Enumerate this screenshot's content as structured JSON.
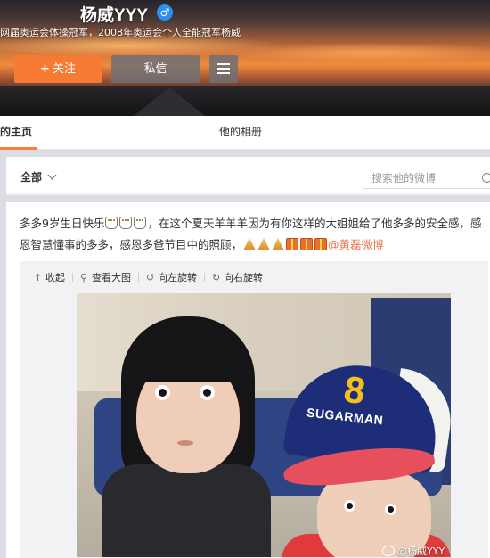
{
  "profile": {
    "name": "杨威YYY",
    "gender_icon": "male-icon",
    "gender_symbol": "♂",
    "description": "网届奥运会体操冠军，2008年奥运会个人全能冠军杨威"
  },
  "actions": {
    "follow_plus": "+",
    "follow_label": "关注",
    "message_label": "私信",
    "more_icon": "menu-icon"
  },
  "tabs": {
    "home_label": "的主页",
    "album_label": "他的相册"
  },
  "filter": {
    "all_label": "全部",
    "search_placeholder": "搜索他的微博"
  },
  "post": {
    "text_part1": "多多9岁生日快乐",
    "text_part2": "，在这个夏天羊羊羊因为有你这样的大姐姐给了他多多的安全感，感恩智慧懂事的多多，感恩多爸节目中的照顾，",
    "mention": "@黄磊微博"
  },
  "media_toolbar": {
    "collapse_label": "收起",
    "view_large_label": "查看大图",
    "rotate_left_label": "向左旋转",
    "rotate_right_label": "向右旋转"
  },
  "photo": {
    "cap_logo": "8",
    "cap_text": "SUGARMAN",
    "watermark": "@杨威YYY"
  },
  "colors": {
    "accent": "#f77a33",
    "mention": "#eb7350",
    "tab_underline": "#fa7d3c"
  }
}
